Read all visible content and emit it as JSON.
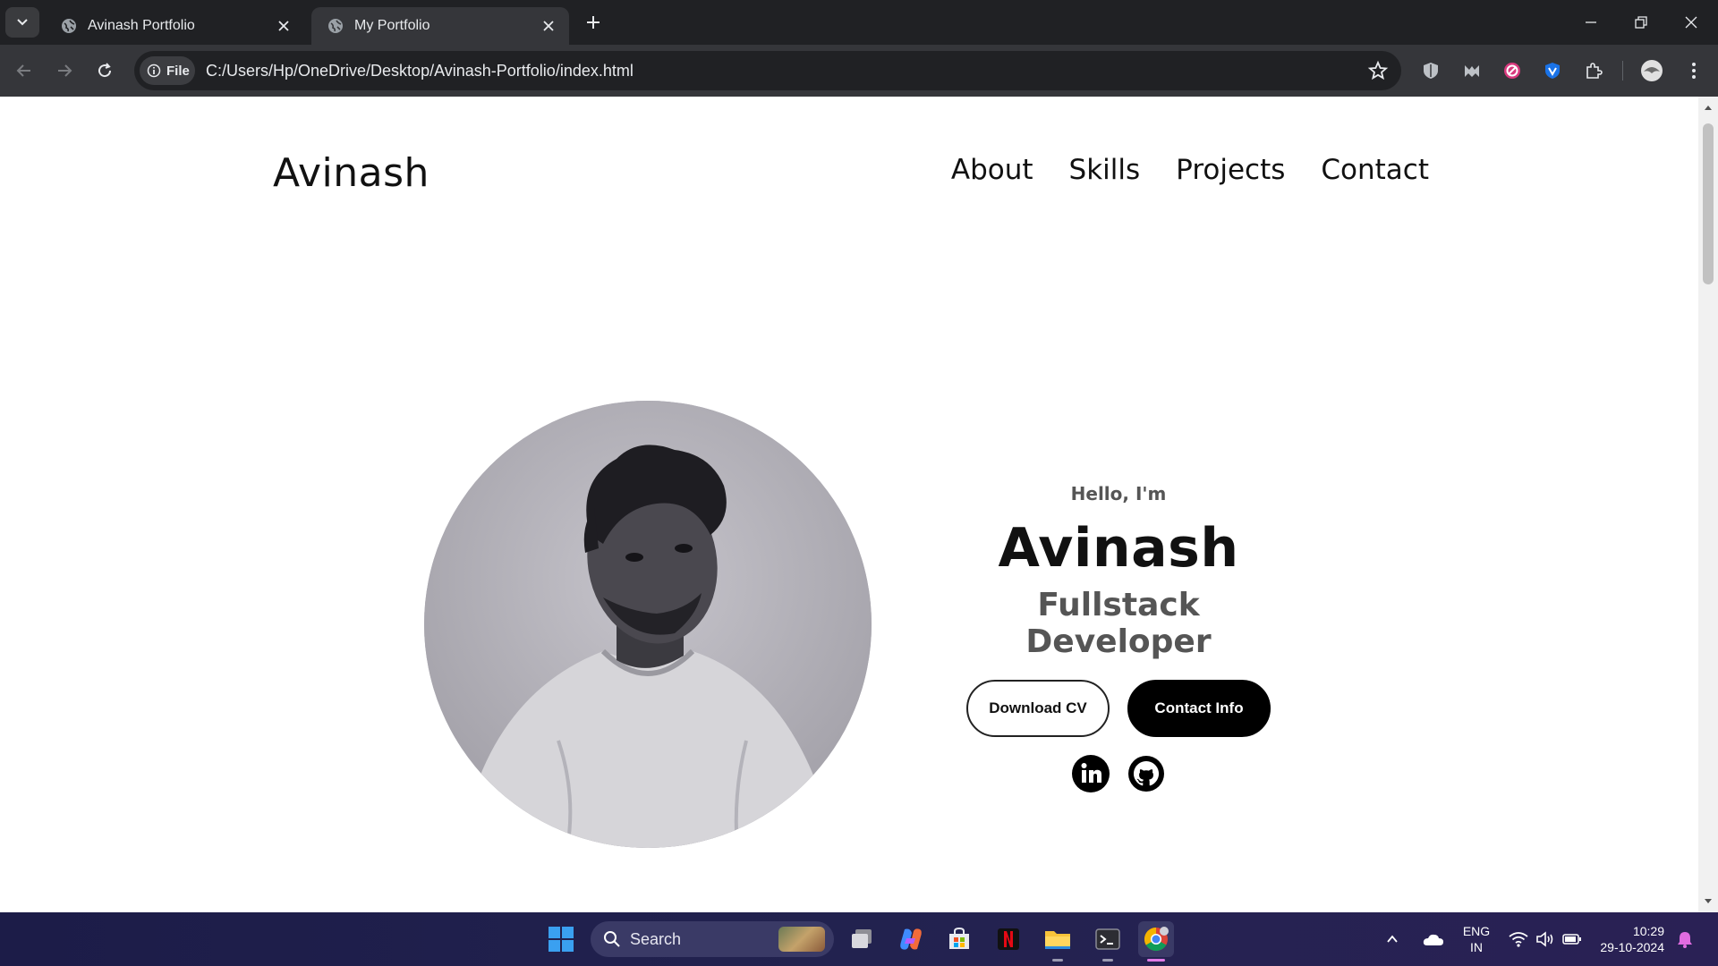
{
  "browser": {
    "tabs": [
      {
        "title": "Avinash Portfolio",
        "active": false
      },
      {
        "title": "My Portfolio",
        "active": true
      }
    ],
    "site_chip": "File",
    "url": "C:/Users/Hp/OneDrive/Desktop/Avinash-Portfolio/index.html"
  },
  "page": {
    "logo": "Avinash",
    "nav": [
      "About",
      "Skills",
      "Projects",
      "Contact"
    ],
    "hello": "Hello, I'm",
    "name": "Avinash",
    "role": "Fullstack Developer",
    "buttons": {
      "download": "Download CV",
      "contact": "Contact Info"
    },
    "socials": [
      "linkedin-icon",
      "github-icon"
    ]
  },
  "taskbar": {
    "search_label": "Search",
    "language": "ENG",
    "region": "IN",
    "time": "10:29",
    "date": "29-10-2024"
  }
}
